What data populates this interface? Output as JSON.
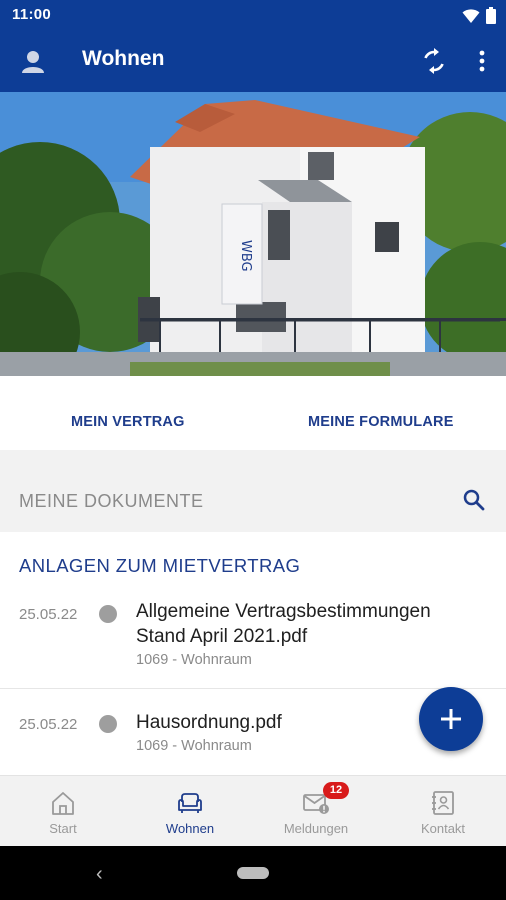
{
  "status_bar": {
    "time": "11:00"
  },
  "app_bar": {
    "title": "Wohnen"
  },
  "links": {
    "contract": "MEIN VERTRAG",
    "forms": "MEINE FORMULARE"
  },
  "documents": {
    "header": "MEINE DOKUMENTE",
    "section_title": "ANLAGEN ZUM MIETVERTRAG",
    "items": [
      {
        "date": "25.05.22",
        "name": "Allgemeine Vertragsbestimmungen Stand April 2021.pdf",
        "meta": "1069 - Wohnraum"
      },
      {
        "date": "25.05.22",
        "name": "Hausordnung.pdf",
        "meta": "1069 - Wohnraum"
      }
    ]
  },
  "hero_sign_text": "WBG",
  "bottom_nav": {
    "items": [
      {
        "label": "Start",
        "icon": "home-icon"
      },
      {
        "label": "Wohnen",
        "icon": "armchair-icon"
      },
      {
        "label": "Meldungen",
        "icon": "mail-alert-icon",
        "badge": "12"
      },
      {
        "label": "Kontakt",
        "icon": "contact-book-icon"
      }
    ],
    "active": "Wohnen"
  },
  "colors": {
    "primary": "#0d3d96",
    "accent_text": "#1f3d8c",
    "badge": "#d81b1b"
  }
}
